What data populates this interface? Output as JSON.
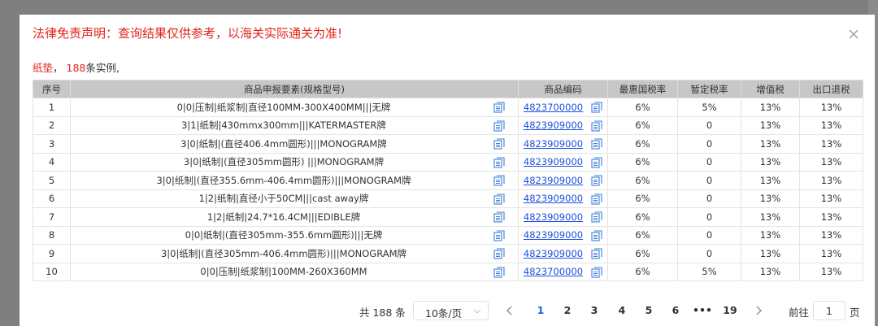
{
  "dialog": {
    "title": "法律免责声明：查询结果仅供参考，以海关实际通关为准!",
    "summary": {
      "keyword": "纸垫",
      "sep": "，",
      "count": "188",
      "suffix": "条实例,"
    }
  },
  "table": {
    "headers": [
      "序号",
      "商品申报要素(规格型号)",
      "商品编码",
      "最惠国税率",
      "暂定税率",
      "增值税",
      "出口退税"
    ],
    "rows": [
      {
        "no": "1",
        "desc": "0|0|压制|纸浆制|直径100MM-300X400MM|||无牌",
        "code": "4823700000",
        "mfn": "6%",
        "tmp": "5%",
        "vat": "13%",
        "rebate": "13%"
      },
      {
        "no": "2",
        "desc": "3|1|纸制|430mmx300mm|||KATERMASTER牌",
        "code": "4823909000",
        "mfn": "6%",
        "tmp": "0",
        "vat": "13%",
        "rebate": "13%"
      },
      {
        "no": "3",
        "desc": "3|0|纸制|(直径406.4mm圆形)|||MONOGRAM牌",
        "code": "4823909000",
        "mfn": "6%",
        "tmp": "0",
        "vat": "13%",
        "rebate": "13%"
      },
      {
        "no": "4",
        "desc": "3|0|纸制|(直径305mm圆形) |||MONOGRAM牌",
        "code": "4823909000",
        "mfn": "6%",
        "tmp": "0",
        "vat": "13%",
        "rebate": "13%"
      },
      {
        "no": "5",
        "desc": "3|0|纸制|(直径355.6mm-406.4mm圆形)|||MONOGRAM牌",
        "code": "4823909000",
        "mfn": "6%",
        "tmp": "0",
        "vat": "13%",
        "rebate": "13%"
      },
      {
        "no": "6",
        "desc": "1|2|纸制|直径小于50CM|||cast away牌",
        "code": "4823909000",
        "mfn": "6%",
        "tmp": "0",
        "vat": "13%",
        "rebate": "13%"
      },
      {
        "no": "7",
        "desc": "1|2|纸制|24.7*16.4CM|||EDIBLE牌",
        "code": "4823909000",
        "mfn": "6%",
        "tmp": "0",
        "vat": "13%",
        "rebate": "13%"
      },
      {
        "no": "8",
        "desc": "0|0|纸制|(直径305mm-355.6mm圆形)|||无牌",
        "code": "4823909000",
        "mfn": "6%",
        "tmp": "0",
        "vat": "13%",
        "rebate": "13%"
      },
      {
        "no": "9",
        "desc": "3|0|纸制|(直径305mm-406.4mm圆形)|||MONOGRAM牌",
        "code": "4823909000",
        "mfn": "6%",
        "tmp": "0",
        "vat": "13%",
        "rebate": "13%"
      },
      {
        "no": "10",
        "desc": "0|0|压制|纸浆制|100MM-260X360MM",
        "code": "4823700000",
        "mfn": "6%",
        "tmp": "5%",
        "vat": "13%",
        "rebate": "13%"
      }
    ]
  },
  "pagination": {
    "total": "共 188 条",
    "page_size": "10条/页",
    "pages": [
      "1",
      "2",
      "3",
      "4",
      "5",
      "6",
      "•••",
      "19"
    ],
    "current": "1",
    "goto_label": "前往",
    "goto_value": "1",
    "goto_unit": "页"
  },
  "icons": {
    "close": "close-icon",
    "copy": "copy-icon",
    "prev": "chevron-left-icon",
    "next": "chevron-right-icon",
    "dropdown": "chevron-down-icon"
  },
  "colors": {
    "warning": "#e2231a",
    "link": "#1d4fe0",
    "active_page": "#1d5ff0",
    "header_bg": "#c7c7c7"
  }
}
